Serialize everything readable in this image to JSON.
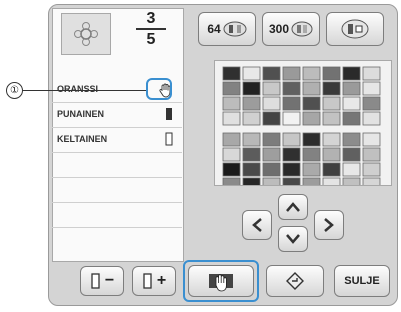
{
  "callout": {
    "number": "①"
  },
  "counter": {
    "current": "3",
    "total": "5"
  },
  "thread_list": [
    {
      "name": "ORANSSI",
      "icon": "hand-icon"
    },
    {
      "name": "PUNAINEN",
      "icon": "spool-icon"
    },
    {
      "name": "KELTAINEN",
      "icon": "empty-spool-icon"
    }
  ],
  "top_buttons": {
    "b64": "64",
    "b300": "300"
  },
  "bottom": {
    "minus_label": "−",
    "plus_label": "+",
    "close_label": "SULJE"
  },
  "palette": {
    "colors": [
      [
        "#303030",
        "#e8e8e8",
        "#505050",
        "#9a9a9a",
        "#bcbcbc",
        "#727272",
        "#2a2a2a",
        "#dcdcdc"
      ],
      [
        "#828282",
        "#222222",
        "#c8c8c8",
        "#606060",
        "#b0b0b0",
        "#3a3a3a",
        "#9a9a9a",
        "#e6e6e6"
      ],
      [
        "#bcbcbc",
        "#9c9c9c",
        "#dedede",
        "#727272",
        "#505050",
        "#c8c8c8",
        "#e8e8e8",
        "#8a8a8a"
      ],
      [
        "#e0e0e0",
        "#d0d0d0",
        "#444444",
        "#f2f2f2",
        "#a6a6a6",
        "#c2c2c2",
        "#767676",
        "#e2e2e2"
      ],
      [
        "#a8a8a8",
        "#b8b8b8",
        "#7c7c7c",
        "#c6c6c6",
        "#2c2c2c",
        "#d4d4d4",
        "#8c8c8c",
        "#e6e6e6"
      ],
      [
        "#d8d8d8",
        "#5c5c5c",
        "#9e9e9e",
        "#303030",
        "#828282",
        "#b2b2b2",
        "#606060",
        "#c0c0c0"
      ],
      [
        "#1a1a1a",
        "#4a4a4a",
        "#6e6e6e",
        "#2a2a2a",
        "#aaaaaa",
        "#404040",
        "#e8e8e8",
        "#cfcfcf"
      ],
      [
        "#8a8a8a",
        "#262626",
        "#bcbcbc",
        "#484848",
        "#9c9c9c",
        "#e4e4e4",
        "#c0c0c0",
        "#d6d6d6"
      ]
    ]
  }
}
